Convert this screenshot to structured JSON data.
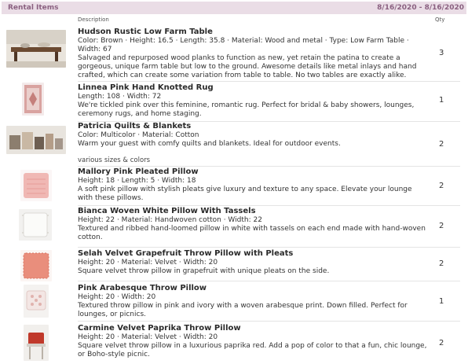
{
  "header": {
    "title": "Rental Items",
    "date_range": "8/16/2020 - 8/16/2020"
  },
  "columns": {
    "description": "Description",
    "qty": "Qty"
  },
  "items": [
    {
      "name": "Hudson Rustic Low Farm Table",
      "specs": "Color: Brown · Height: 16.5 · Length: 35.8 · Material: Wood and metal · Type: Low Farm Table · Width: 67",
      "description": "Salvaged and repurposed wood planks to function as new, yet retain the patina to create a gorgeous, unique farm table but low to the ground. Awesome details like metal inlays and hand crafted, which can create some variation from table to table. No two tables are exactly alike.",
      "qty": "3",
      "thumb_icon": "farm-table-icon"
    },
    {
      "name": "Linnea Pink Hand Knotted Rug",
      "specs": "Length: 108 · Width: 72",
      "description": "We're tickled pink over this feminine, romantic rug. Perfect for bridal & baby showers, lounges, ceremony rugs, and home staging.",
      "qty": "1",
      "thumb_icon": "rug-icon"
    },
    {
      "name": "Patricia Quilts & Blankets",
      "specs": "Color: Multicolor · Material: Cotton",
      "description": "Warm your guest with comfy quilts and blankets. Ideal for outdoor events.",
      "note": "various sizes & colors",
      "qty": "2",
      "thumb_icon": "quilts-icon"
    },
    {
      "name": "Mallory Pink Pleated Pillow",
      "specs": "Height: 18 · Length: 5 · Width: 18",
      "description": "A soft pink pillow with stylish pleats give luxury and texture to any space. Elevate your lounge with these pillows.",
      "qty": "2",
      "thumb_icon": "pink-pillow-icon"
    },
    {
      "name": "Bianca Woven White Pillow With Tassels",
      "specs": "Height: 22 · Material: Handwoven cotton · Width: 22",
      "description": "Textured and ribbed hand-loomed pillow in white with tassels on each end made with hand-woven cotton.",
      "qty": "2",
      "thumb_icon": "white-pillow-icon"
    },
    {
      "name": "Selah Velvet Grapefruit Throw Pillow with Pleats",
      "specs": "Height: 20 · Material: Velvet · Width: 20",
      "description": "Square velvet throw pillow in grapefruit with unique pleats on the side.",
      "qty": "2",
      "thumb_icon": "grapefruit-pillow-icon"
    },
    {
      "name": "Pink Arabesque Throw Pillow",
      "specs": "Height: 20 · Width: 20",
      "description": "Textured throw pillow in pink and ivory with a woven arabesque print. Down filled. Perfect for lounges, or picnics.",
      "qty": "1",
      "thumb_icon": "arabesque-pillow-icon"
    },
    {
      "name": "Carmine Velvet Paprika Throw Pillow",
      "specs": "Height: 20 · Material: Velvet · Width: 20",
      "description": "Square velvet throw pillow in a luxurious paprika red. Add a pop of color to that a fun, chic lounge, or Boho-style picnic.",
      "qty": "2",
      "thumb_icon": "paprika-pillow-icon"
    }
  ]
}
